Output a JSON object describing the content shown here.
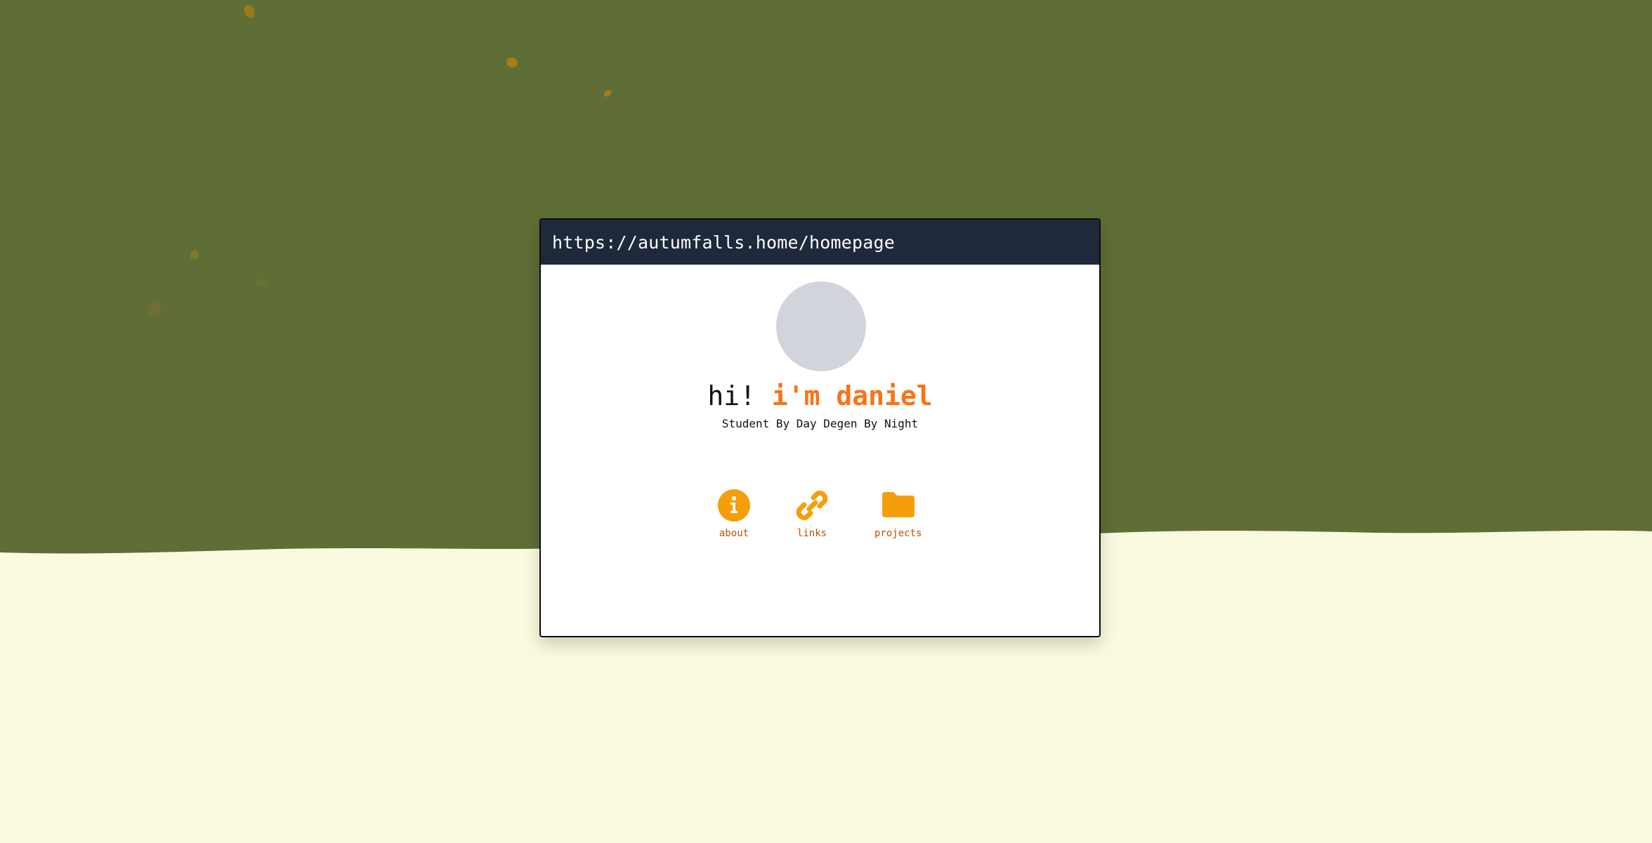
{
  "colors": {
    "sky": "#5f6d37",
    "ground": "#fafadf",
    "titlebar": "#1e293b",
    "accent": "#f97316",
    "icon": "#f59e0b",
    "label": "#b45309",
    "avatar": "#d1d5db"
  },
  "window": {
    "url": "https://autumfalls.home/homepage"
  },
  "profile": {
    "avatar_icon": "avatar-placeholder",
    "greeting_prefix": "hi!",
    "name": "i'm daniel",
    "tagline": "Student By Day Degen By Night"
  },
  "nav": [
    {
      "label": "about",
      "icon": "info-icon"
    },
    {
      "label": "links",
      "icon": "link-icon"
    },
    {
      "label": "projects",
      "icon": "folder-icon"
    }
  ]
}
